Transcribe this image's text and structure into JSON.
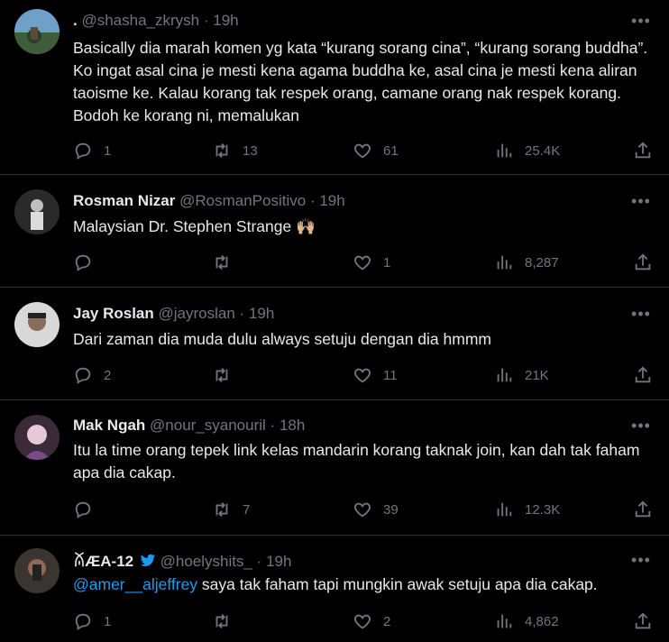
{
  "tweets": [
    {
      "name": ".",
      "handle": "@shasha_zkrysh",
      "time": "19h",
      "text": "Basically dia marah komen yg kata “kurang sorang cina”, “kurang sorang buddha”.  Ko ingat asal cina je mesti kena agama buddha ke, asal cina je mesti kena aliran taoisme ke. Kalau korang tak respek orang, camane orang nak respek korang. Bodoh ke korang ni, memalukan",
      "replies": "1",
      "retweets": "13",
      "likes": "61",
      "views": "25.4K"
    },
    {
      "name": "Rosman Nizar",
      "handle": "@RosmanPositivo",
      "time": "19h",
      "text": "Malaysian Dr. Stephen Strange 🙌🏼",
      "replies": "",
      "retweets": "",
      "likes": "1",
      "views": "8,287"
    },
    {
      "name": "Jay Roslan",
      "handle": "@jayroslan",
      "time": "19h",
      "text": "Dari zaman dia muda dulu always setuju dengan dia hmmm",
      "replies": "2",
      "retweets": "",
      "likes": "11",
      "views": "21K"
    },
    {
      "name": "Mak Ngah",
      "handle": "@nour_syanouril",
      "time": "18h",
      "text": "Itu la time orang tepek link kelas mandarin korang taknak join, kan dah tak faham apa dia cakap.",
      "replies": "",
      "retweets": "7",
      "likes": "39",
      "views": "12.3K"
    },
    {
      "name": "ꊼÆA-12",
      "handle": "@hoelyshits_",
      "time": "19h",
      "mention": "@amer__aljeffrey",
      "text": " saya tak faham tapi mungkin awak setuju apa dia cakap.",
      "replies": "1",
      "retweets": "",
      "likes": "2",
      "views": "4,862"
    }
  ],
  "ui": {
    "more": "•••",
    "sep": "·"
  }
}
